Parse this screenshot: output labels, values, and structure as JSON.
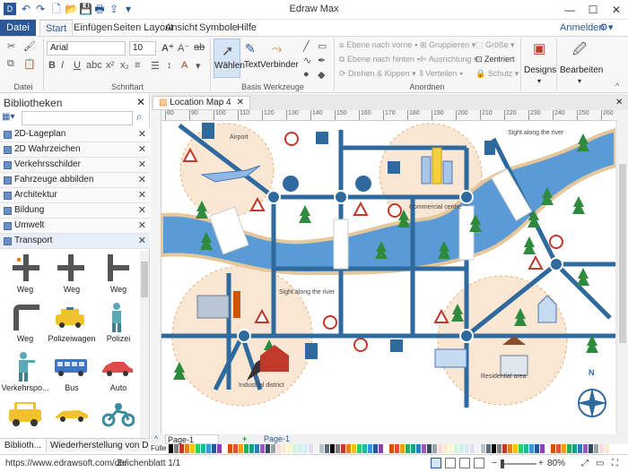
{
  "app": {
    "title": "Edraw Max"
  },
  "menu": {
    "file": "Datei",
    "tabs": [
      "Start",
      "Einfügen",
      "Seiten Layout",
      "Ansicht",
      "Symbole",
      "Hilfe"
    ],
    "signin": "Anmelden"
  },
  "ribbon": {
    "font": "Arial",
    "size": "10",
    "groups": {
      "file": "Datei",
      "font": "Schriftart",
      "basic": "Basis Werkzeuge",
      "arrange": "Anordnen"
    },
    "tools": {
      "select": "Wählen",
      "text": "Text",
      "connector": "Verbinder"
    },
    "arrange": {
      "front": "Ebene nach vorne",
      "back": "Ebene nach hinten",
      "rotate": "Drehen & Kippen",
      "group": "Gruppieren",
      "align": "Ausrichtung",
      "distribute": "Verteilen",
      "size": "Größe",
      "center": "Zentriert",
      "protect": "Schutz"
    },
    "designs": "Designs",
    "edit": "Bearbeiten"
  },
  "library": {
    "title": "Bibliotheken",
    "search_placeholder": "",
    "categories": [
      "2D-Lageplan",
      "2D Wahrzeichen",
      "Verkehrsschilder",
      "Fahrzeuge abbilden",
      "Architektur",
      "Bildung",
      "Umwelt",
      "Transport"
    ],
    "shapes": [
      "Weg",
      "Weg",
      "Weg",
      "Weg",
      "Polizeiwagen",
      "Polizei",
      "Verkehrspo...",
      "Bus",
      "Auto"
    ],
    "bottom_tabs": [
      "Biblioth...",
      "Wiederherstellung von Da..."
    ]
  },
  "document": {
    "tab": "Location Map 4",
    "ruler": [
      "80",
      "90",
      "100",
      "110",
      "120",
      "130",
      "140",
      "150",
      "160",
      "170",
      "180",
      "190",
      "200",
      "210",
      "220",
      "230",
      "240",
      "250",
      "260"
    ],
    "labels": {
      "airport": "Airport",
      "sight1": "Sight along the river",
      "commercial": "Commercial centre",
      "sight2": "Sight along the river",
      "industrial": "Industrial district",
      "residential": "Residential area",
      "north": "N"
    }
  },
  "pages": {
    "current": "Page-1",
    "tab": "Page-1",
    "fill_label": "Füller"
  },
  "status": {
    "url": "https://www.edrawsoft.com/de/",
    "sheet": "Zeichenblatt 1/1",
    "zoom": "80%"
  },
  "colors": {
    "accent": "#2b5797",
    "road": "#2e6a9e",
    "river": "#5b9bd5",
    "tree": "#2e8b3e",
    "zone": "#f6dcc1"
  }
}
